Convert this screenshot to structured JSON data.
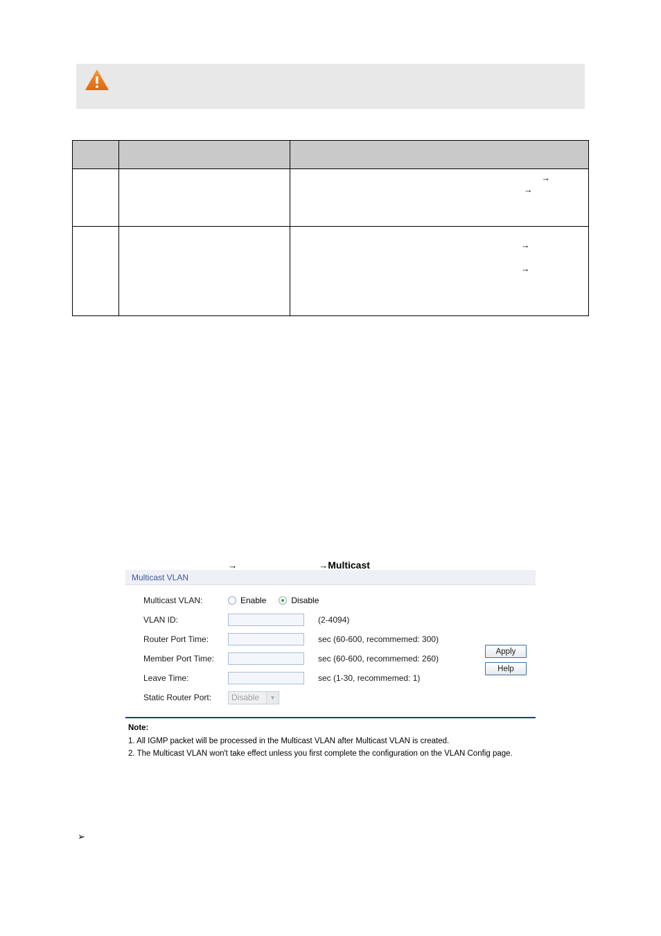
{
  "callout": {
    "icon": "warning-triangle-icon",
    "text": ""
  },
  "spec_table": {
    "headers": [
      "",
      "",
      ""
    ],
    "rows": [
      {
        "num": "",
        "term": "",
        "description_line1": "→",
        "description_line2": "→"
      },
      {
        "num": "",
        "term": "",
        "description_line1": "→",
        "description_line2": "→"
      }
    ]
  },
  "nav_path": {
    "arrow1": "→",
    "arrow2": "→",
    "target": "Multicast"
  },
  "panel": {
    "title": "Multicast VLAN",
    "rows": {
      "multicast_vlan": {
        "label": "Multicast VLAN:",
        "options": [
          {
            "label": "Enable",
            "selected": false
          },
          {
            "label": "Disable",
            "selected": true
          }
        ]
      },
      "vlan_id": {
        "label": "VLAN ID:",
        "value": "",
        "hint": "(2-4094)"
      },
      "router_port_time": {
        "label": "Router Port Time:",
        "value": "",
        "hint": "sec (60-600, recommemed: 300)"
      },
      "member_port_time": {
        "label": "Member Port Time:",
        "value": "",
        "hint": "sec (60-600, recommemed: 260)"
      },
      "leave_time": {
        "label": "Leave Time:",
        "value": "",
        "hint": "sec (1-30, recommemed: 1)"
      },
      "static_router_port": {
        "label": "Static Router Port:",
        "value": "Disable",
        "disabled": true
      }
    },
    "buttons": {
      "apply": "Apply",
      "help": "Help"
    },
    "note": {
      "title": "Note:",
      "line1": "1. All IGMP packet will be processed in the Multicast VLAN after Multicast VLAN is created.",
      "line2": "2. The Multicast VLAN won't take effect unless you first complete the configuration on the VLAN Config page."
    }
  },
  "bullet": {
    "glyph": "➢",
    "text": ""
  },
  "colors": {
    "panel_header_bg": "#eef0f5",
    "panel_header_text": "#3b5998",
    "table_header_bg": "#c9c9c9",
    "callout_bg": "#e8e8e8",
    "warning_orange": "#e8761f",
    "radio_green": "#2fa82f",
    "note_rule": "#1f3f77",
    "button_border": "#3b6ea5"
  }
}
